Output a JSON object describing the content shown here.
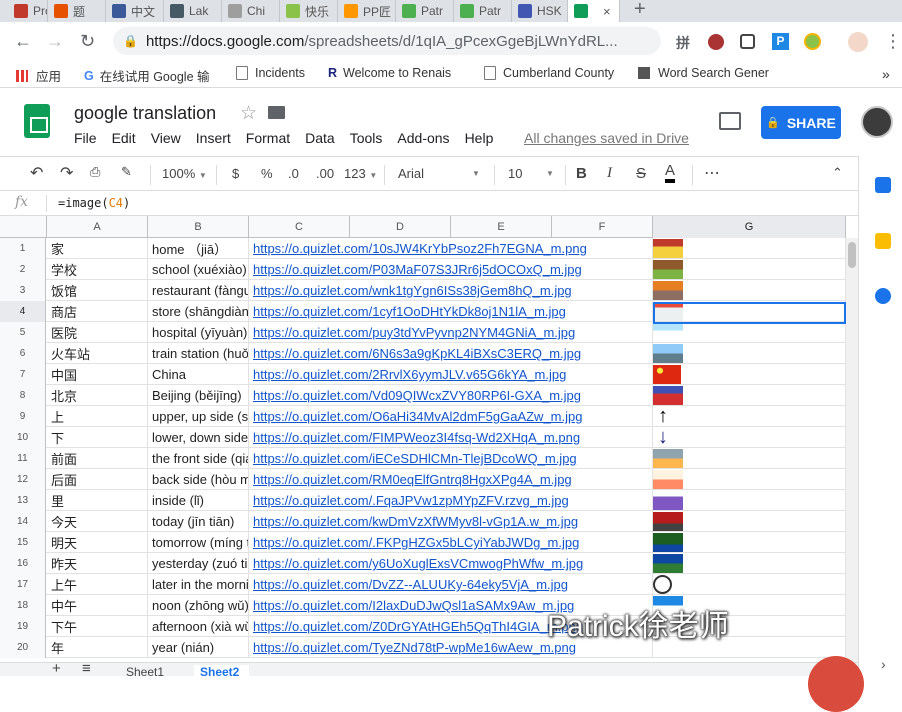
{
  "browser": {
    "tabs": [
      {
        "label": "Pro",
        "color": "#c0392b"
      },
      {
        "label": "题",
        "color": "#e65100"
      },
      {
        "label": "中文",
        "color": "#3b5998"
      },
      {
        "label": "Lak",
        "color": "#455a64"
      },
      {
        "label": "Chi",
        "color": "#9e9e9e"
      },
      {
        "label": "快乐",
        "color": "#8bc34a"
      },
      {
        "label": "PP匠",
        "color": "#ff9800"
      },
      {
        "label": "Patr",
        "color": "#4caf50"
      },
      {
        "label": "Patr",
        "color": "#4caf50"
      },
      {
        "label": "HSK",
        "color": "#4257b2"
      },
      {
        "label": "",
        "color": "#0f9d58",
        "active": true
      }
    ],
    "url_host": "https://docs.google.com",
    "url_path": "/spreadsheets/d/1qIA_gPcexGgeBjLWnYdRL...",
    "bookmarks": [
      "应用",
      "在线试用 Google 输",
      "Incidents",
      "Welcome to Renais",
      "Cumberland County",
      "Word Search Gener"
    ]
  },
  "doc": {
    "title": "google translation",
    "menu": [
      "File",
      "Edit",
      "View",
      "Insert",
      "Format",
      "Data",
      "Tools",
      "Add-ons",
      "Help"
    ],
    "saved_status": "All changes saved in Drive",
    "share_label": "SHARE"
  },
  "format_toolbar": {
    "zoom": "100%",
    "currency": "$",
    "percent": "%",
    "dec_less": ".0",
    "dec_more": ".00",
    "more_formats": "123",
    "font": "Arial",
    "font_size": "10"
  },
  "formula_bar": {
    "fx": "fx",
    "formula_prefix": "=image(",
    "formula_ref": "C4",
    "formula_suffix": ")"
  },
  "columns": [
    "A",
    "B",
    "C",
    "D",
    "E",
    "F",
    "G"
  ],
  "rows": [
    {
      "n": "1",
      "a": "家",
      "b": "home （jiā）",
      "c": "https://o.quizlet.com/10sJW4KrYbPsoz2Fh7EGNA_m.png",
      "img": "house"
    },
    {
      "n": "2",
      "a": "学校",
      "b": "school (xuéxiào)",
      "c": "https://o.quizlet.com/P03MaF07S3JRr6j5dOCOxQ_m.jpg",
      "img": "school"
    },
    {
      "n": "3",
      "a": "饭馆",
      "b": "restaurant (fàngu",
      "c": "https://o.quizlet.com/wnk1tgYgn6ISs38jGem8hQ_m.jpg",
      "img": "restaurant"
    },
    {
      "n": "4",
      "a": "商店",
      "b": "store (shāngdiàn",
      "c": "https://o.quizlet.com/1cyf1OoDHtYkDk8oj1N1lA_m.jpg",
      "img": "store"
    },
    {
      "n": "5",
      "a": "医院",
      "b": "hospital (yīyuàn)",
      "c": "https://o.quizlet.com/puy3tdYvPyvnp2NYM4GNiA_m.jpg",
      "img": "hospital"
    },
    {
      "n": "6",
      "a": "火车站",
      "b": "train station (huǒ",
      "c": "https://o.quizlet.com/6N6s3a9gKpKL4iBXsC3ERQ_m.jpg",
      "img": "station"
    },
    {
      "n": "7",
      "a": "中国",
      "b": "China",
      "c": "https://o.quizlet.com/2RrvlX6yymJLV.v65G6kYA_m.jpg",
      "img": "flag"
    },
    {
      "n": "8",
      "a": "北京",
      "b": "Beijing (běijīng)",
      "c": "https://o.quizlet.com/Vd09QIWcxZVY80RP6I-GXA_m.jpg",
      "img": "beijing"
    },
    {
      "n": "9",
      "a": "上",
      "b": "upper, up side (s",
      "c": "https://o.quizlet.com/O6aHi34MvAl2dmF5gGaAZw_m.jpg",
      "img": "arrow-up"
    },
    {
      "n": "10",
      "a": "下",
      "b": "lower, down side",
      "c": "https://o.quizlet.com/FIMPWeoz3I4fsq-Wd2XHqA_m.png",
      "img": "arrow-down"
    },
    {
      "n": "11",
      "a": "前面",
      "b": "the front side (qia",
      "c": "https://o.quizlet.com/iECeSDHlCMn-TlejBDcoWQ_m.jpg",
      "img": "front"
    },
    {
      "n": "12",
      "a": "后面",
      "b": "back side (hòu m",
      "c": "https://o.quizlet.com/RM0eqElfGntrq8HgxXPg4A_m.jpg",
      "img": "back"
    },
    {
      "n": "13",
      "a": "里",
      "b": "inside (lǐ)",
      "c": "https://o.quizlet.com/.FqaJPVw1zpMYpZFV.rzvg_m.jpg",
      "img": "inside"
    },
    {
      "n": "14",
      "a": "今天",
      "b": "today (jīn tiān)",
      "c": "https://o.quizlet.com/kwDmVzXfWMyv8l-vGp1A.w_m.jpg",
      "img": "today"
    },
    {
      "n": "15",
      "a": "明天",
      "b": "tomorrow (míng t",
      "c": "https://o.quizlet.com/.FKPgHZGx5bLCyiYabJWDg_m.jpg",
      "img": "tomorrow"
    },
    {
      "n": "16",
      "a": "昨天",
      "b": "yesterday (zuó ti",
      "c": "https://o.quizlet.com/y6UoXuglExsVCmwogPhWfw_m.jpg",
      "img": "yesterday"
    },
    {
      "n": "17",
      "a": "上午",
      "b": "later in the morni",
      "c": "https://o.quizlet.com/DvZZ--ALUUKy-64eky5VjA_m.jpg",
      "img": "clock"
    },
    {
      "n": "18",
      "a": "中午",
      "b": "noon (zhōng wǔ)",
      "c": "https://o.quizlet.com/I2laxDuDJwQsl1aSAMx9Aw_m.jpg",
      "img": "noon"
    },
    {
      "n": "19",
      "a": "下午",
      "b": "afternoon (xià wǔ",
      "c": "https://o.quizlet.com/Z0DrGYAtHGEh5QqThI4GIA_m.png",
      "img": "none"
    },
    {
      "n": "20",
      "a": "年",
      "b": "year (nián)",
      "c": "https://o.quizlet.com/TyeZNd78tP-wpMe16wAew_m.png",
      "img": "none"
    }
  ],
  "sheets": [
    "Sheet1",
    "Sheet2"
  ],
  "watermark": "Patrick徐老师"
}
